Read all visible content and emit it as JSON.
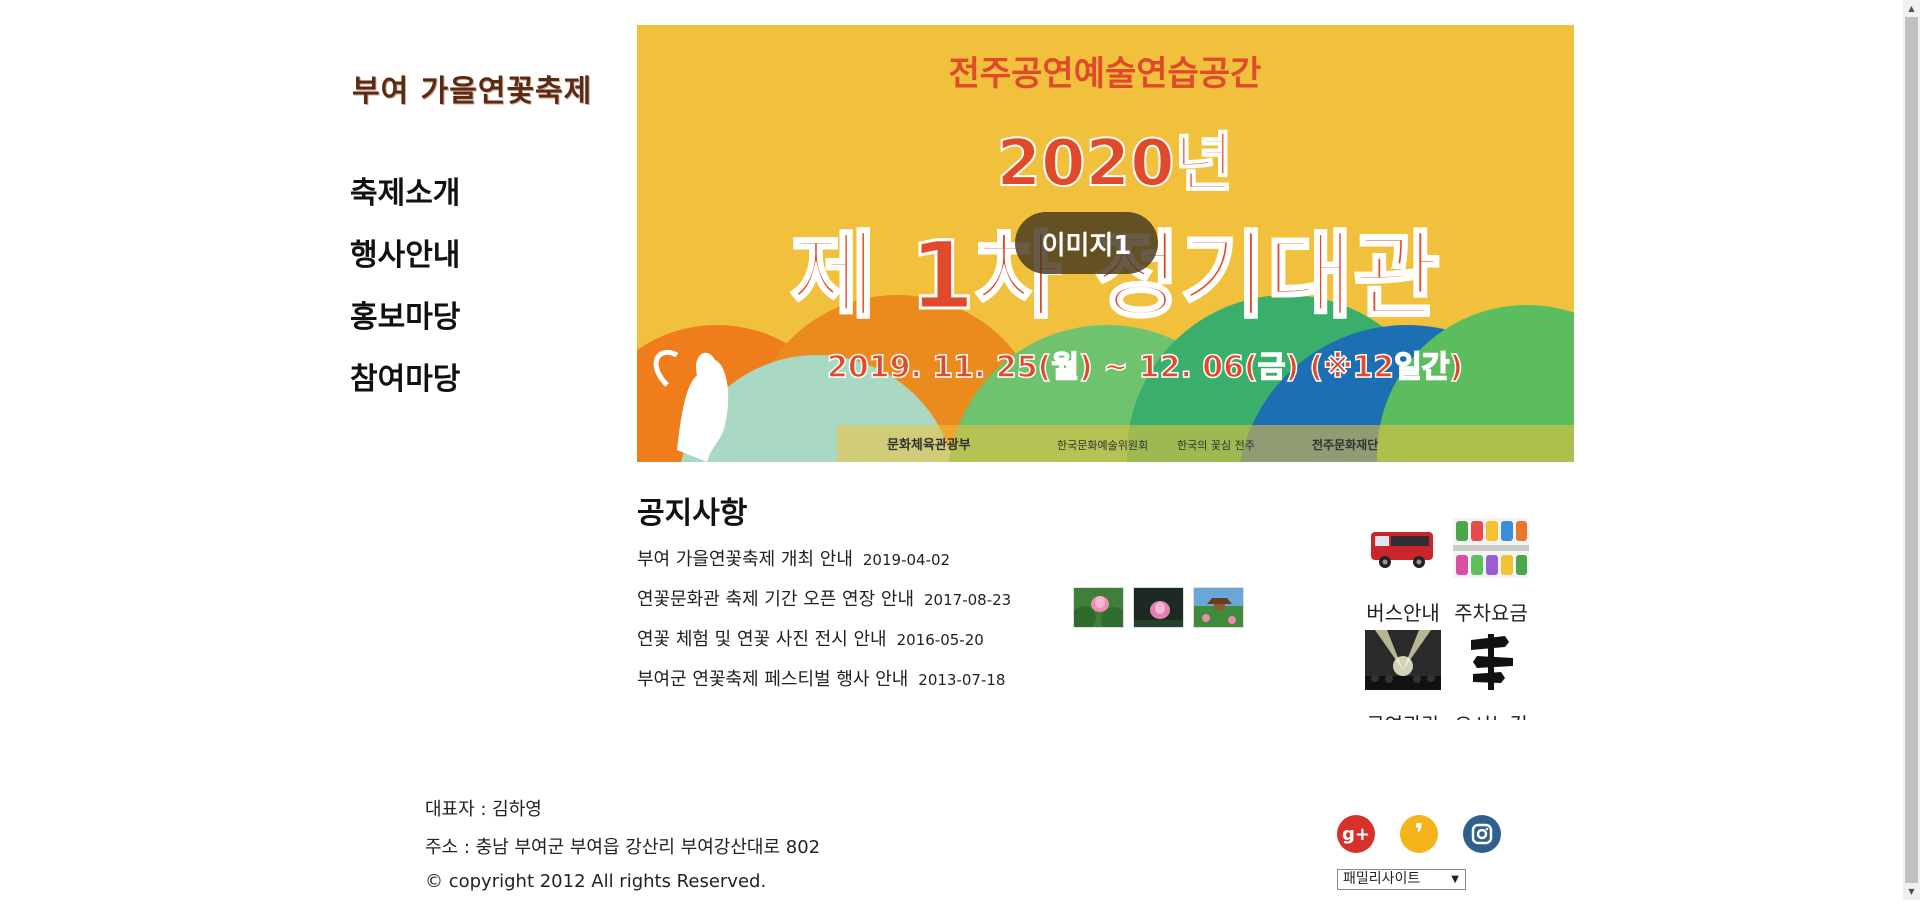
{
  "site": {
    "logo": "부여 가을연꽃축제"
  },
  "nav": {
    "items": [
      "축제소개",
      "행사안내",
      "홍보마당",
      "참여마당"
    ]
  },
  "banner": {
    "top_text": "전주공연예술연습공간",
    "year": "2020년",
    "headline": "제 1차 정기대관",
    "period": "2019. 11. 25(월) ~ 12. 06(금) (※12일간)",
    "sponsors": [
      "문화체육관광부",
      "한국문화예술위원회",
      "한국의 꽃심 전주",
      "전주문화재단"
    ],
    "slide_label": "이미지1",
    "background_color": "#f1c13e",
    "text_color": "#e04a2a"
  },
  "notice": {
    "title": "공지사항",
    "items": [
      {
        "title": "부여 가을연꽃축제 개최 안내",
        "date": "2019-04-02"
      },
      {
        "title": "연꽃문화관 축제 기간 오픈 연장 안내",
        "date": "2017-08-23"
      },
      {
        "title": "연꽃 체험 및 연꽃 사진 전시 안내",
        "date": "2016-05-20"
      },
      {
        "title": "부여군 연꽃축제 페스티벌 행사 안내",
        "date": "2013-07-18"
      }
    ]
  },
  "gallery": {
    "thumbnails": [
      "lotus-pink-thumbnail",
      "lotus-dark-thumbnail",
      "lotus-pavilion-thumbnail"
    ]
  },
  "quick_links": [
    {
      "label": "버스안내",
      "icon": "bus-icon"
    },
    {
      "label": "주차요금",
      "icon": "parking-lot-icon"
    },
    {
      "label": "공연관람",
      "icon": "concert-icon"
    },
    {
      "label": "오시는길",
      "icon": "signpost-icon"
    }
  ],
  "footer": {
    "representative": "대표자 : 김하영",
    "address": "주소 : 충남 부여군 부여읍 강산리 부여강산대로 802",
    "copyright": "© copyright 2012 All rights Reserved."
  },
  "sns": [
    {
      "name": "google-plus",
      "symbol": "g+",
      "color": "#d8302a"
    },
    {
      "name": "kakao",
      "symbol": "❜",
      "color": "#f4b41a"
    },
    {
      "name": "instagram",
      "symbol": "",
      "color": "#2f5f8f"
    }
  ],
  "family_site": {
    "selected": "패밀리사이트"
  }
}
